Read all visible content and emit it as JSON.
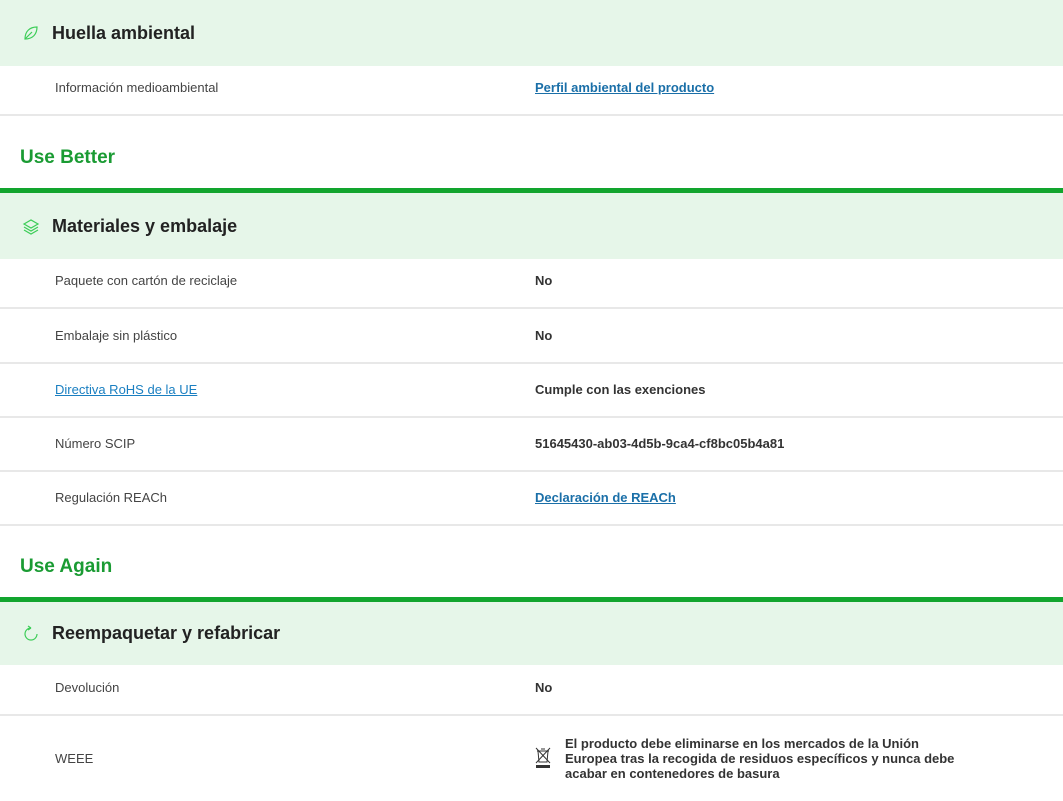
{
  "sections": {
    "footprint": {
      "icon": "leaf-icon",
      "title": "Huella ambiental",
      "rows": [
        {
          "label": "Información medioambiental",
          "value": "Perfil ambiental del producto"
        }
      ]
    },
    "materials": {
      "icon": "layers-icon",
      "title": "Materiales y embalaje",
      "rows": [
        {
          "label": "Paquete con cartón de reciclaje",
          "value": "No"
        },
        {
          "label": "Embalaje sin plástico",
          "value": "No"
        },
        {
          "label": "Directiva RoHS de la UE",
          "value": "Cumple con las exenciones"
        },
        {
          "label": "Número SCIP",
          "value": "51645430-ab03-4d5b-9ca4-cf8bc05b4a81"
        },
        {
          "label": "Regulación REACh",
          "value": "Declaración de REACh"
        }
      ]
    },
    "repack": {
      "icon": "refresh-icon",
      "title": "Reempaquetar y refabricar",
      "rows": [
        {
          "label": "Devolución",
          "value": "No"
        },
        {
          "label": "WEEE",
          "value": "El producto debe eliminarse en los mercados de la Unión Europea tras la recogida de residuos específicos y nunca debe acabar en contenedores de basura",
          "icon": "crossed-bin-icon"
        }
      ]
    }
  },
  "groups": {
    "use_better": "Use Better",
    "use_again": "Use Again"
  },
  "colors": {
    "header_bg": "#e6f6e9",
    "accent_green": "#12a52e",
    "group_title": "#1a9b33",
    "link": "#1a7fc1"
  }
}
